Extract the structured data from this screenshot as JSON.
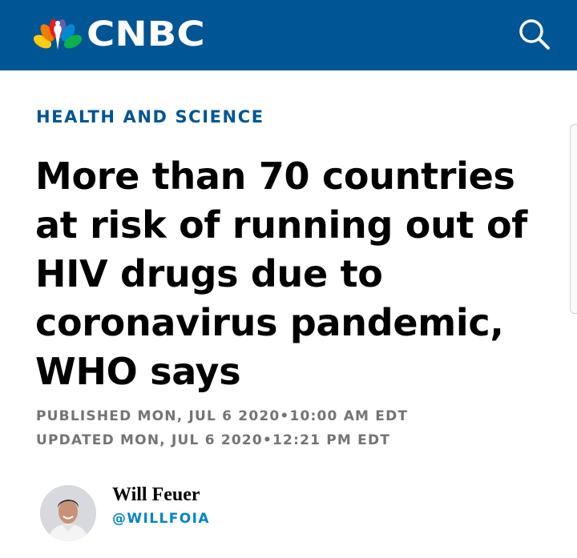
{
  "header": {
    "logo_text": "CNBC",
    "brand_color": "#005594",
    "logo_icon": "nbc-peacock-icon",
    "search_icon": "search-icon"
  },
  "article": {
    "section": "HEALTH AND SCIENCE",
    "headline": "More than 70 countries at risk of running out of HIV drugs due to coronavirus pandemic, WHO says",
    "published": "PUBLISHED MON, JUL 6 2020•10:00 AM EDT",
    "updated": "UPDATED MON, JUL 6 2020•12:21 PM EDT",
    "section_color": "#005594",
    "meta_color": "#747474"
  },
  "author": {
    "name": "Will Feuer",
    "handle": "@WILLFOIA",
    "handle_color": "#0084c5"
  }
}
